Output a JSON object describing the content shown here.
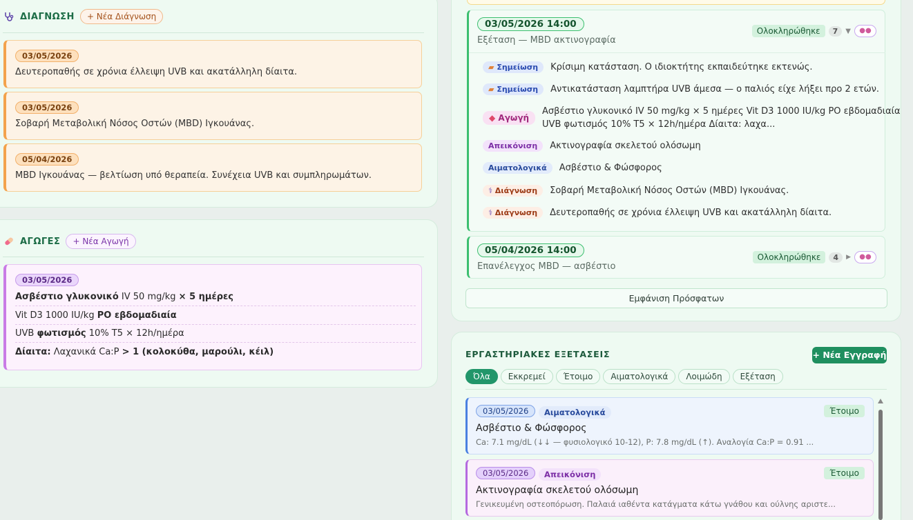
{
  "diagnosis": {
    "icon": "stethoscope-icon",
    "title": "ΔΙΑΓΝΩΣΗ",
    "new_label": "+ Νέα Διάγνωση",
    "items": [
      {
        "date": "03/05/2026",
        "text": "Δευτεροπαθής σε χρόνια έλλειψη UVB και ακατάλληλη δίαιτα."
      },
      {
        "date": "03/05/2026",
        "text": "Σοβαρή Μεταβολική Νόσος Οστών (MBD) Ιγκουάνας."
      },
      {
        "date": "05/04/2026",
        "text": "MBD Ιγκουάνας — βελτίωση υπό θεραπεία. Συνέχεια UVB και συμπληρωμάτων."
      }
    ]
  },
  "treatments": {
    "icon": "pill-icon",
    "title": "ΑΓΩΓΕΣ",
    "new_label": "+ Νέα Αγωγή",
    "date": "03/05/2026",
    "lines": [
      {
        "bold1": "Ασβέστιο γλυκονικό",
        "mid": " IV 50 mg/kg ",
        "bold2": "× 5 ημέρες"
      },
      {
        "bold1": "",
        "mid": "Vit D3 1000 IU/kg ",
        "bold2": "PO εβδομαδιαία"
      },
      {
        "bold1": "",
        "mid": "UVB ",
        "bold2": "φωτισμός",
        "rest": " 10% T5 × 12h/ημέρα"
      },
      {
        "bold1": "Δίαιτα:",
        "mid": " Λαχανικά Ca:P ",
        "bold2": "> 1 (κολοκύθα, μαρούλι, κέιλ)"
      }
    ]
  },
  "visits": [
    {
      "date": "03/05/2026 14:00",
      "subtitle": "Εξέταση — MBD ακτινογραφία",
      "status": "Ολοκληρώθηκε",
      "count": "7",
      "toggle": "▼",
      "entries": [
        {
          "tag": "Σημείωση",
          "tag_icon": "note-icon",
          "kind": "note",
          "text": "Κρίσιμη κατάσταση. Ο ιδιοκτήτης εκπαιδεύτηκε εκτενώς."
        },
        {
          "tag": "Σημείωση",
          "tag_icon": "note-icon",
          "kind": "note",
          "text": "Αντικατάσταση λαμπτήρα UVB άμεσα — ο παλιός είχε λήξει προ 2 ετών."
        },
        {
          "tag": "Αγωγή",
          "tag_icon": "pill-icon",
          "kind": "treat",
          "text": "Ασβέστιο γλυκονικό IV 50 mg/kg × 5 ημέρες Vit D3 1000 IU/kg PO εβδομαδιαία",
          "text2": "UVB φωτισμός 10% T5 × 12h/ημέρα Δίαιτα: λαχα..."
        },
        {
          "tag": "Απεικόνιση",
          "tag_icon": "",
          "kind": "img",
          "text": "Ακτινογραφία σκελετού ολόσωμη"
        },
        {
          "tag": "Αιματολογικά",
          "tag_icon": "",
          "kind": "blood",
          "text": "Ασβέστιο & Φώσφορος"
        },
        {
          "tag": "Διάγνωση",
          "tag_icon": "stethoscope-icon",
          "kind": "diag",
          "text": "Σοβαρή Μεταβολική Νόσος Οστών (MBD) Ιγκουάνας."
        },
        {
          "tag": "Διάγνωση",
          "tag_icon": "stethoscope-icon",
          "kind": "diag",
          "text": "Δευτεροπαθής σε χρόνια έλλειψη UVB και ακατάλληλη δίαιτα."
        }
      ]
    },
    {
      "date": "05/04/2026 14:00",
      "subtitle": "Επανέλεγχος MBD — ασβέστιο",
      "status": "Ολοκληρώθηκε",
      "count": "4",
      "toggle": "▶"
    }
  ],
  "show_recent_label": "Εμφάνιση Πρόσφατων",
  "labs": {
    "title": "ΕΡΓΑΣΤΗΡΙΑΚΕΣ ΕΞΕΤΑΣΕΙΣ",
    "new_label": "+ Νέα Εγγραφή",
    "filters": [
      "Όλα",
      "Εκκρεμεί",
      "Έτοιμο",
      "Αιματολογικά",
      "Λοιμώδη",
      "Εξέταση"
    ],
    "active_filter": "Όλα",
    "items": [
      {
        "date": "03/05/2026",
        "type": "Αιματολογικά",
        "status": "Έτοιμο",
        "title": "Ασβέστιο & Φώσφορος",
        "summary": "Ca: 7.1 mg/dL (↓↓ — φυσιολογικό 10-12), P: 7.8 mg/dL (↑). Αναλογία Ca:P = 0.91 ..."
      },
      {
        "date": "03/05/2026",
        "type": "Απεικόνιση",
        "status": "Έτοιμο",
        "title": "Ακτινογραφία σκελετού ολόσωμη",
        "summary": "Γενικευμένη οστεοπόρωση. Παλαιά ιαθέντα κατάγματα κάτω γνάθου και ούλνης αριστε..."
      }
    ]
  }
}
